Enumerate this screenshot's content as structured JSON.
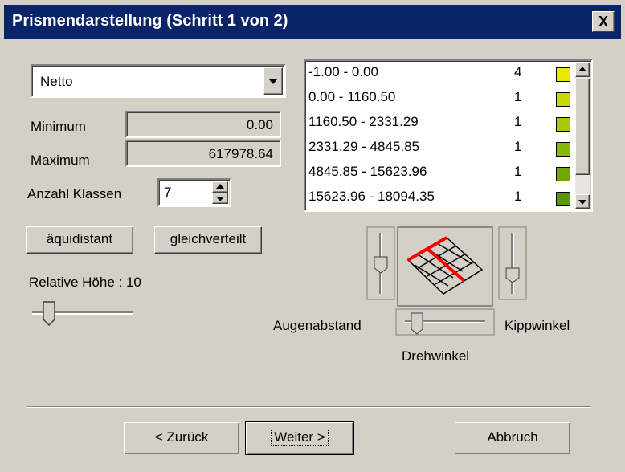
{
  "window": {
    "title": "Prismendarstellung  (Schritt 1 von 2)",
    "close_label": "X"
  },
  "attribute_select": {
    "value": "Netto"
  },
  "stats": {
    "minimum_label": "Minimum",
    "minimum_value": "0.00",
    "maximum_label": "Maximum",
    "maximum_value": "617978.64"
  },
  "classes": {
    "label": "Anzahl Klassen",
    "value": "7"
  },
  "buttons": {
    "equidistant": "äquidistant",
    "equal_distribution": "gleichverteilt",
    "back": "< Zurück",
    "next": "Weiter >",
    "cancel": "Abbruch"
  },
  "relative_height": {
    "label": "Relative Höhe : 10",
    "value": 10
  },
  "class_list": [
    {
      "range": "-1.00 - 0.00",
      "count": "4",
      "color": "#e8e800"
    },
    {
      "range": "0.00 - 1160.50",
      "count": "1",
      "color": "#c8d800"
    },
    {
      "range": "1160.50 - 2331.29",
      "count": "1",
      "color": "#a8c800"
    },
    {
      "range": "2331.29 - 4845.85",
      "count": "1",
      "color": "#88b800"
    },
    {
      "range": "4845.85 - 15623.96",
      "count": "1",
      "color": "#70a800"
    },
    {
      "range": "15623.96 - 18094.35",
      "count": "1",
      "color": "#589800"
    }
  ],
  "view_controls": {
    "eye_distance_label": "Augenabstand",
    "tilt_label": "Kippwinkel",
    "rotation_label": "Drehwinkel"
  },
  "colors": {
    "titlebar": "#0a246a",
    "face": "#d4d0c8",
    "preview_axis": "#ff0000"
  }
}
